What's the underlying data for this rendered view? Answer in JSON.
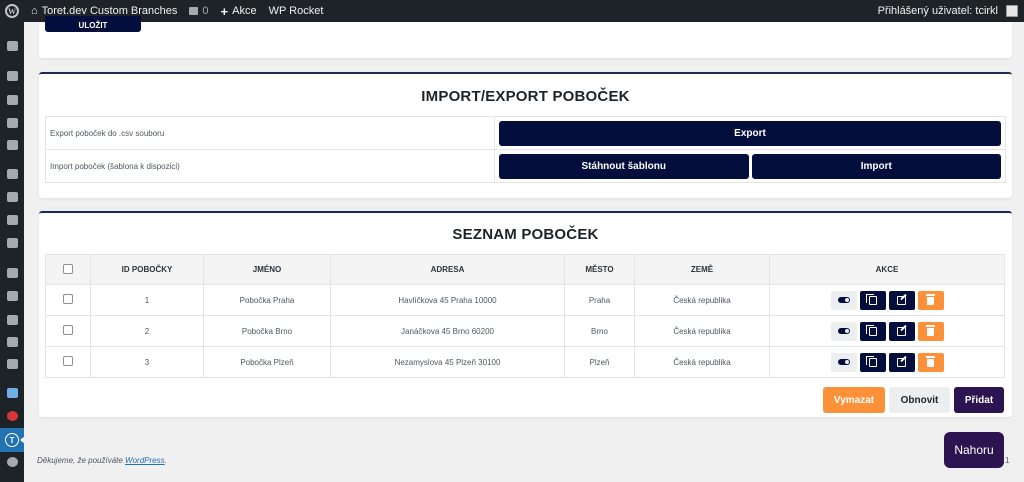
{
  "adminbar": {
    "site_name": "Toret.dev Custom Branches",
    "comments_count": "0",
    "new_label": "Akce",
    "wp_rocket": "WP Rocket",
    "user_greeting": "Přihlášený uživatel: tcirkl"
  },
  "top_card": {
    "save_label": "ULOŽIT"
  },
  "import_export": {
    "title": "IMPORT/EXPORT POBOČEK",
    "export_label": "Export poboček do .csv souboru",
    "export_button": "Export",
    "import_label": "Import poboček (šablona k dispozici)",
    "download_template_button": "Stáhnout šablonu",
    "import_button": "Import"
  },
  "branches": {
    "title": "SEZNAM POBOČEK",
    "columns": [
      "ID POBOČKY",
      "JMÉNO",
      "ADRESA",
      "MĚSTO",
      "ZEMĚ",
      "AKCE"
    ],
    "rows": [
      {
        "id": "1",
        "name": "Pobočka Praha",
        "address": "Havlíčkova 45 Praha 10000",
        "city": "Praha",
        "country": "Česká republika"
      },
      {
        "id": "2",
        "name": "Pobočka Brno",
        "address": "Janáčkova 45 Brno 60200",
        "city": "Brno",
        "country": "Česká republika"
      },
      {
        "id": "3",
        "name": "Pobočka Plzeň",
        "address": "Nezamyslova 45 Plzeň 30100",
        "city": "Plzeň",
        "country": "Česká republika"
      }
    ],
    "delete_button": "Vymazat",
    "refresh_button": "Obnovit",
    "add_button": "Přidat"
  },
  "footer": {
    "thanks_prefix": "Děkujeme, že používáte ",
    "wordpress_link": "WordPress",
    "thanks_suffix": ".",
    "version": "1"
  },
  "scroll_top_button": "Nahoru",
  "colors": {
    "navy": "#030e3d",
    "orange": "#fd913a",
    "purple": "#2c1450",
    "wp_blue": "#2271b1"
  }
}
